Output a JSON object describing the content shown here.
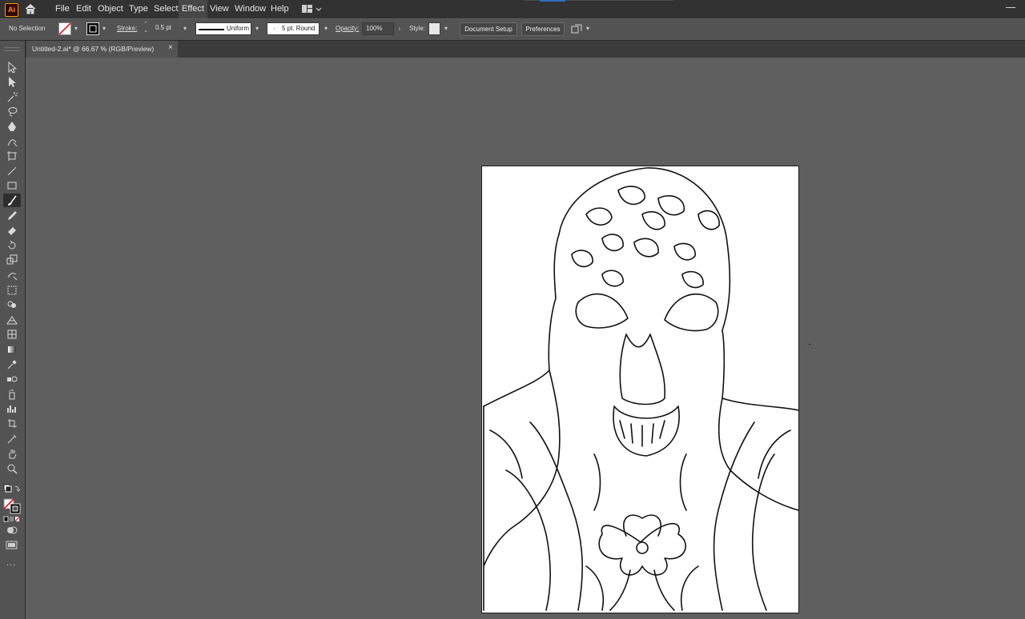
{
  "app": {
    "logo_text": "Ai"
  },
  "menu": [
    "File",
    "Edit",
    "Object",
    "Type",
    "Select",
    "Effect",
    "View",
    "Window",
    "Help"
  ],
  "menu_active": "Effect",
  "control_bar": {
    "selection_status": "No Selection",
    "stroke_label": "Stroke:",
    "stroke_weight": "0.5 pt",
    "profile": "Uniform",
    "brush": "5 pt. Round",
    "opacity_label": "Opacity:",
    "opacity": "100%",
    "style_label": "Style:",
    "document_setup": "Document Setup",
    "preferences": "Preferences"
  },
  "document_tab": {
    "title": "Untitled-2.ai* @ 66.67 % (RGB/Preview)",
    "close": "×"
  },
  "toolbar": {
    "more": "...",
    "tools": [
      "selection-tool",
      "direct-selection-tool",
      "magic-wand-tool",
      "lasso-tool",
      "pen-tool",
      "curvature-tool",
      "artboard-tool",
      "line-segment-tool",
      "rectangle-tool",
      "paintbrush-tool",
      "pencil-tool",
      "eraser-tool",
      "rotate-tool",
      "scale-tool",
      "warp-tool",
      "free-transform-tool",
      "shape-builder-tool",
      "perspective-grid-tool",
      "mesh-tool",
      "gradient-tool",
      "eyedropper-tool",
      "blend-tool",
      "symbol-sprayer-tool",
      "column-graph-tool",
      "slice-tool",
      "eraser-alt-tool",
      "hand-tool",
      "zoom-tool"
    ],
    "selected_tool": "paintbrush-tool"
  },
  "colors": {
    "accent": "#2f6fc1",
    "brand": "#ff9a00",
    "workspace": "#5f5f5f",
    "panel": "#535353"
  }
}
